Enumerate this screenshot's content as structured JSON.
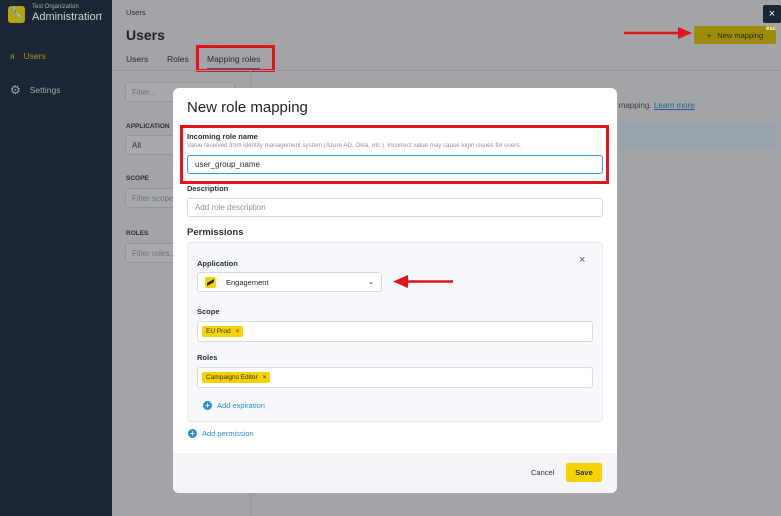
{
  "sidebar": {
    "org": "Test Organization",
    "title": "Administration",
    "items": [
      {
        "label": "Users",
        "icon": "users-icon"
      },
      {
        "label": "Settings",
        "icon": "gear-icon"
      }
    ]
  },
  "header": {
    "breadcrumb": "Users",
    "title": "Users",
    "tabs": [
      "Users",
      "Roles",
      "Mapping roles"
    ],
    "new_mapping": "New mapping",
    "close": "×",
    "esc": "esc"
  },
  "filters": {
    "filter_placeholder": "Filter...",
    "application_label": "APPLICATION",
    "application_value": "All",
    "scope_label": "SCOPE",
    "scope_placeholder": "Filter scope",
    "roles_label": "ROLES",
    "roles_placeholder": "Filter roles..."
  },
  "content": {
    "info_text": "e mapping.",
    "learn_more": "Learn more"
  },
  "modal": {
    "title": "New role mapping",
    "incoming_label": "Incoming role name",
    "incoming_hint": "Value received from identity management system (Azure AD, Okta, etc.). Incorrect value may cause login issues for users.",
    "incoming_value": "user_group_name",
    "description_label": "Description",
    "description_placeholder": "Add role description",
    "permissions_label": "Permissions",
    "application_label": "Application",
    "application_value": "Engagement",
    "scope_label": "Scope",
    "scope_chips": [
      "EU Prod"
    ],
    "roles_label": "Roles",
    "roles_chips": [
      "Campaigns Editor"
    ],
    "add_expiration": "Add expiration",
    "add_permission": "Add permission",
    "cancel": "Cancel",
    "save": "Save"
  },
  "colors": {
    "accent": "#f6d200",
    "link": "#2c8fc9",
    "annotation": "#e0141b"
  }
}
